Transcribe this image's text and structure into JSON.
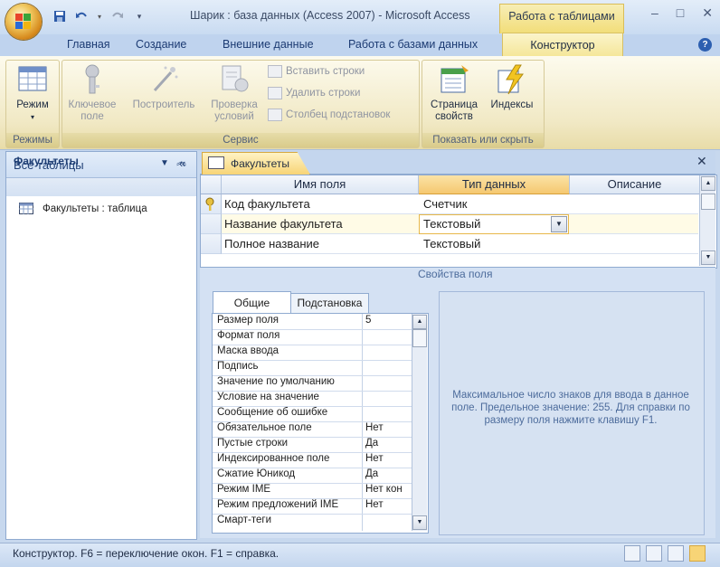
{
  "window": {
    "title": "Шарик : база данных (Access 2007) - Microsoft Access",
    "context_tab_group": "Работа с таблицами",
    "controls": [
      "–",
      "□",
      "✕"
    ]
  },
  "ribbon_tabs": [
    {
      "label": "Главная"
    },
    {
      "label": "Создание"
    },
    {
      "label": "Внешние данные"
    },
    {
      "label": "Работа с базами данных"
    },
    {
      "label": "Конструктор",
      "active": true
    }
  ],
  "ribbon_groups": {
    "views": {
      "label": "Режимы",
      "mode_button": "Режим"
    },
    "tools": {
      "label": "Сервис",
      "key_field": "Ключевое поле",
      "builder": "Построитель",
      "test_rules": "Проверка условий",
      "insert_rows": "Вставить строки",
      "delete_rows": "Удалить строки",
      "lookup_column": "Столбец подстановок"
    },
    "show_hide": {
      "label": "Показать или скрыть",
      "property_sheet": "Страница свойств",
      "indexes": "Индексы"
    }
  },
  "nav_pane": {
    "title": "Все таблицы",
    "group": "Факультеты",
    "item": "Факультеты : таблица"
  },
  "document": {
    "tab_label": "Факультеты",
    "close": "✕"
  },
  "design_grid": {
    "headers": [
      "Имя поля",
      "Тип данных",
      "Описание"
    ],
    "rows": [
      {
        "name": "Код факультета",
        "type": "Счетчик",
        "description": "",
        "key": true
      },
      {
        "name": "Название факультета",
        "type": "Текстовый",
        "description": "",
        "selected": true
      },
      {
        "name": "Полное название",
        "type": "Текстовый",
        "description": ""
      }
    ]
  },
  "field_properties": {
    "title": "Свойства поля",
    "tabs": [
      "Общие",
      "Подстановка"
    ],
    "rows": [
      {
        "label": "Размер поля",
        "value": "5"
      },
      {
        "label": "Формат поля",
        "value": ""
      },
      {
        "label": "Маска ввода",
        "value": ""
      },
      {
        "label": "Подпись",
        "value": ""
      },
      {
        "label": "Значение по умолчанию",
        "value": ""
      },
      {
        "label": "Условие на значение",
        "value": ""
      },
      {
        "label": "Сообщение об ошибке",
        "value": ""
      },
      {
        "label": "Обязательное поле",
        "value": "Нет"
      },
      {
        "label": "Пустые строки",
        "value": "Да"
      },
      {
        "label": "Индексированное поле",
        "value": "Нет"
      },
      {
        "label": "Сжатие Юникод",
        "value": "Да"
      },
      {
        "label": "Режим IME",
        "value": "Нет кон"
      },
      {
        "label": "Режим предложений IME",
        "value": "Нет"
      },
      {
        "label": "Смарт-теги",
        "value": ""
      }
    ],
    "help_text": "Максимальное число знаков для ввода в данное поле. Предельное значение: 255. Для справки по размеру поля нажмите клавишу F1."
  },
  "status_bar": {
    "text": "Конструктор.  F6 = переключение окон.  F1 = справка."
  },
  "colors": {
    "accent_tab": "#f4e594",
    "ribbon_bg": "#f1e9c5",
    "frame_blue": "#c7d8ee"
  }
}
